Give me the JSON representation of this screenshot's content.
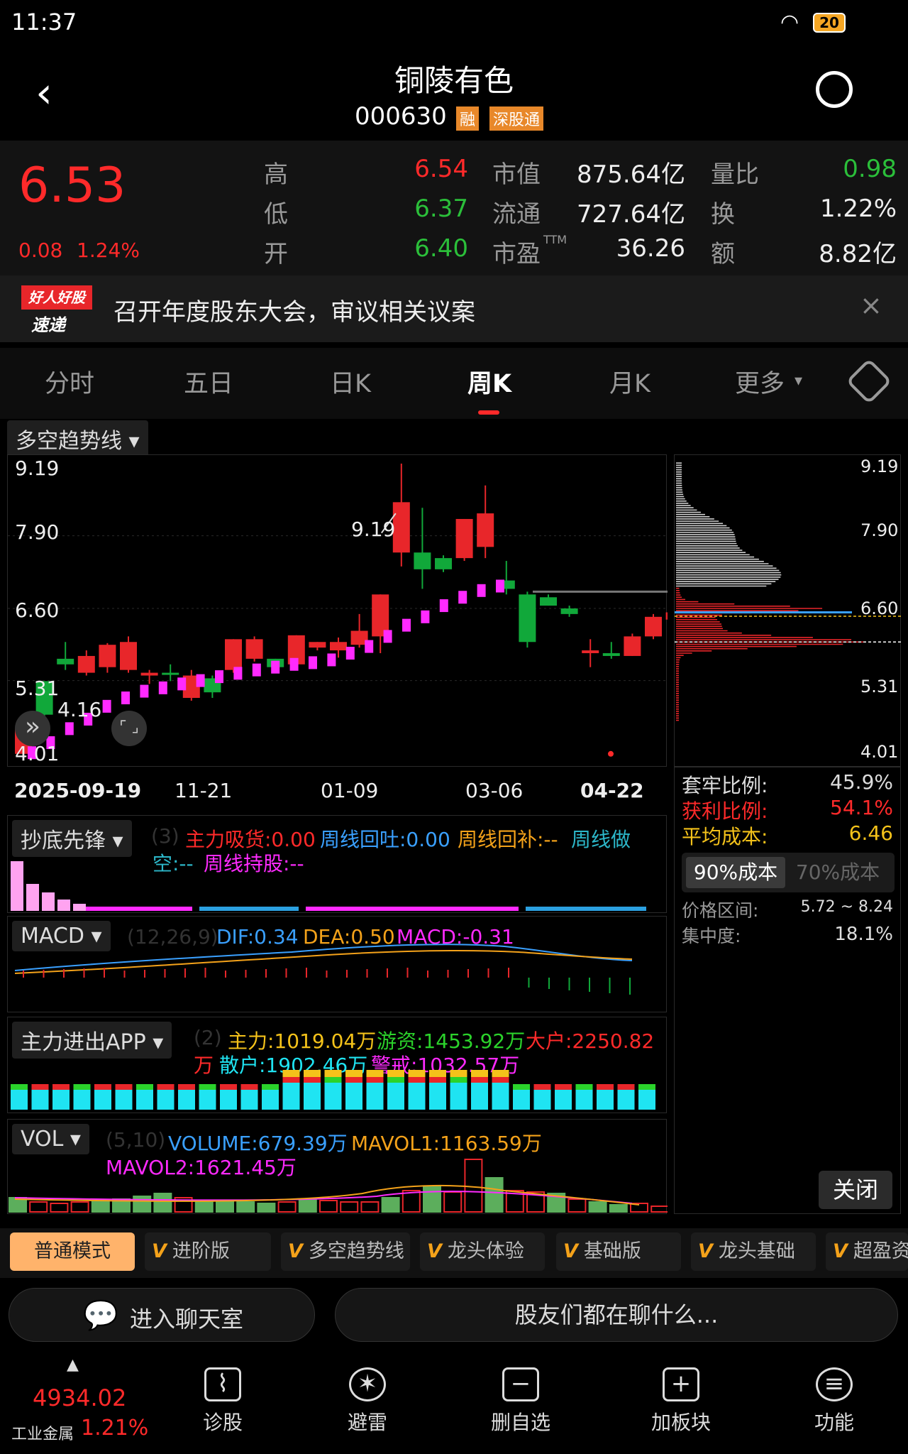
{
  "status": {
    "time": "11:37",
    "battery": "20"
  },
  "header": {
    "name": "铜陵有色",
    "code": "000630",
    "badge_rong": "融",
    "badge_sgt": "深股通"
  },
  "quote": {
    "price": "6.53",
    "change": "0.08",
    "change_pct": "1.24%",
    "high_label": "高",
    "high": "6.54",
    "low_label": "低",
    "low": "6.37",
    "open_label": "开",
    "open": "6.40",
    "mktcap_label": "市值",
    "mktcap": "875.64亿",
    "float_label": "流通",
    "float": "727.64亿",
    "pe_label": "市盈",
    "pe_sup": "TTM",
    "pe": "36.26",
    "volratio_label": "量比",
    "volratio": "0.98",
    "turnover_label": "换",
    "turnover": "1.22%",
    "amount_label": "额",
    "amount": "8.82亿"
  },
  "news": {
    "logo_top": "好人好股",
    "logo_bottom": "速递",
    "text": "召开年度股东大会，审议相关议案"
  },
  "tabs": [
    "分时",
    "五日",
    "日K",
    "周K",
    "月K",
    "更多"
  ],
  "active_tab": "周K",
  "indicator_select": "多空趋势线",
  "chart_data": {
    "type": "candlestick",
    "ylim": [
      4.01,
      9.19
    ],
    "y_ticks": [
      "9.19",
      "7.90",
      "6.60",
      "5.31",
      "4.01"
    ],
    "x_labels": [
      "2025-09-19",
      "11-21",
      "01-09",
      "03-06",
      "04-22"
    ],
    "annotations": {
      "max": "9.19",
      "min": "4.16"
    },
    "candles": [
      {
        "o": 4.0,
        "c": 4.45,
        "h": 4.55,
        "l": 3.95
      },
      {
        "o": 5.3,
        "c": 4.7,
        "h": 5.3,
        "l": 4.6
      },
      {
        "o": 5.7,
        "c": 5.6,
        "h": 6.0,
        "l": 5.5
      },
      {
        "o": 5.45,
        "c": 5.75,
        "h": 5.85,
        "l": 5.4
      },
      {
        "o": 5.55,
        "c": 5.95,
        "h": 5.98,
        "l": 5.45
      },
      {
        "o": 5.5,
        "c": 6.0,
        "h": 6.1,
        "l": 5.45
      },
      {
        "o": 5.4,
        "c": 5.45,
        "h": 5.5,
        "l": 5.25
      },
      {
        "o": 5.45,
        "c": 5.43,
        "h": 5.6,
        "l": 5.3
      },
      {
        "o": 5.0,
        "c": 5.4,
        "h": 5.5,
        "l": 4.95
      },
      {
        "o": 5.35,
        "c": 5.1,
        "h": 5.4,
        "l": 5.0
      },
      {
        "o": 5.5,
        "c": 6.05,
        "h": 6.05,
        "l": 5.45
      },
      {
        "o": 5.7,
        "c": 6.05,
        "h": 6.1,
        "l": 5.65
      },
      {
        "o": 5.7,
        "c": 5.55,
        "h": 5.7,
        "l": 5.55
      },
      {
        "o": 5.6,
        "c": 6.12,
        "h": 6.12,
        "l": 5.55
      },
      {
        "o": 5.9,
        "c": 6.0,
        "h": 6.0,
        "l": 5.85
      },
      {
        "o": 5.85,
        "c": 6.0,
        "h": 6.08,
        "l": 5.72
      },
      {
        "o": 5.95,
        "c": 6.2,
        "h": 6.5,
        "l": 5.9
      },
      {
        "o": 6.1,
        "c": 6.85,
        "h": 6.85,
        "l": 5.8
      },
      {
        "o": 7.6,
        "c": 8.5,
        "h": 9.19,
        "l": 7.35
      },
      {
        "o": 7.6,
        "c": 7.3,
        "h": 8.4,
        "l": 6.95
      },
      {
        "o": 7.5,
        "c": 7.3,
        "h": 7.55,
        "l": 7.25
      },
      {
        "o": 7.5,
        "c": 8.2,
        "h": 8.2,
        "l": 7.45
      },
      {
        "o": 7.7,
        "c": 8.3,
        "h": 8.8,
        "l": 7.5
      },
      {
        "o": 7.1,
        "c": 6.95,
        "h": 7.45,
        "l": 6.85
      },
      {
        "o": 6.85,
        "c": 6.0,
        "h": 6.9,
        "l": 5.9
      },
      {
        "o": 6.8,
        "c": 6.65,
        "h": 6.85,
        "l": 6.65
      },
      {
        "o": 6.6,
        "c": 6.5,
        "h": 6.65,
        "l": 6.45
      },
      {
        "o": 5.8,
        "c": 5.85,
        "h": 6.05,
        "l": 5.55
      },
      {
        "o": 5.8,
        "c": 5.75,
        "h": 6.0,
        "l": 5.7
      },
      {
        "o": 5.75,
        "c": 6.1,
        "h": 6.15,
        "l": 5.75
      },
      {
        "o": 6.1,
        "c": 6.45,
        "h": 6.5,
        "l": 6.05
      },
      {
        "o": 6.4,
        "c": 6.53,
        "h": 6.54,
        "l": 6.37
      }
    ],
    "trend": [
      4.02,
      4.2,
      4.45,
      4.62,
      4.85,
      5.0,
      5.12,
      5.18,
      5.25,
      5.31,
      5.38,
      5.44,
      5.5,
      5.55,
      5.6,
      5.63,
      5.68,
      5.8,
      5.92,
      6.1,
      6.3,
      6.45,
      6.65,
      6.8,
      6.92,
      7.0
    ]
  },
  "nav": {
    "prev_label": "»",
    "expand_label": "⌜ ⌟"
  },
  "cost": {
    "trapped_label": "套牢比例:",
    "trapped": "45.9%",
    "profit_label": "获利比例:",
    "profit": "54.1%",
    "avg_label": "平均成本:",
    "avg": "6.46",
    "btn90": "90%成本",
    "btn70": "70%成本",
    "range_label": "价格区间:",
    "range": "5.72 ~ 8.24",
    "conc_label": "集中度:",
    "conc": "18.1%",
    "close": "关闭"
  },
  "ind1": {
    "select": "抄底先锋",
    "param": "(3)",
    "a": "主力吸货:0.00",
    "b": "周线回吐:0.00",
    "c": "周线回补:--",
    "d": "周线做",
    "e": "空:--",
    "f": "周线持股:--"
  },
  "macd": {
    "select": "MACD",
    "param": "(12,26,9)",
    "dif": "DIF:0.34",
    "dea": "DEA:0.50",
    "macd": "MACD:-0.31"
  },
  "zl": {
    "select": "主力进出APP",
    "param": "(2)",
    "a": "主力:1019.04万",
    "b": "游资:1453.92万",
    "c": "大户:2250.82",
    "d": "万",
    "e": "散户:1902.46万",
    "f": "警戒:1032.57万"
  },
  "vol": {
    "select": "VOL",
    "param": "(5,10)",
    "a": "VOLUME:679.39万",
    "b": "MAVOL1:1163.59万",
    "c": "MAVOL2:1621.45万"
  },
  "modes": [
    "普通模式",
    "进阶版",
    "多空趋势线",
    "龙头体验",
    "基础版",
    "龙头基础",
    "超盈资"
  ],
  "chat": {
    "enter": "进入聊天室",
    "talk": "股友们都在聊什么..."
  },
  "index": {
    "value": "4934.02",
    "name": "工业金属",
    "pct": "1.21%"
  },
  "bottom": [
    "诊股",
    "避雷",
    "删自选",
    "加板块",
    "功能"
  ]
}
